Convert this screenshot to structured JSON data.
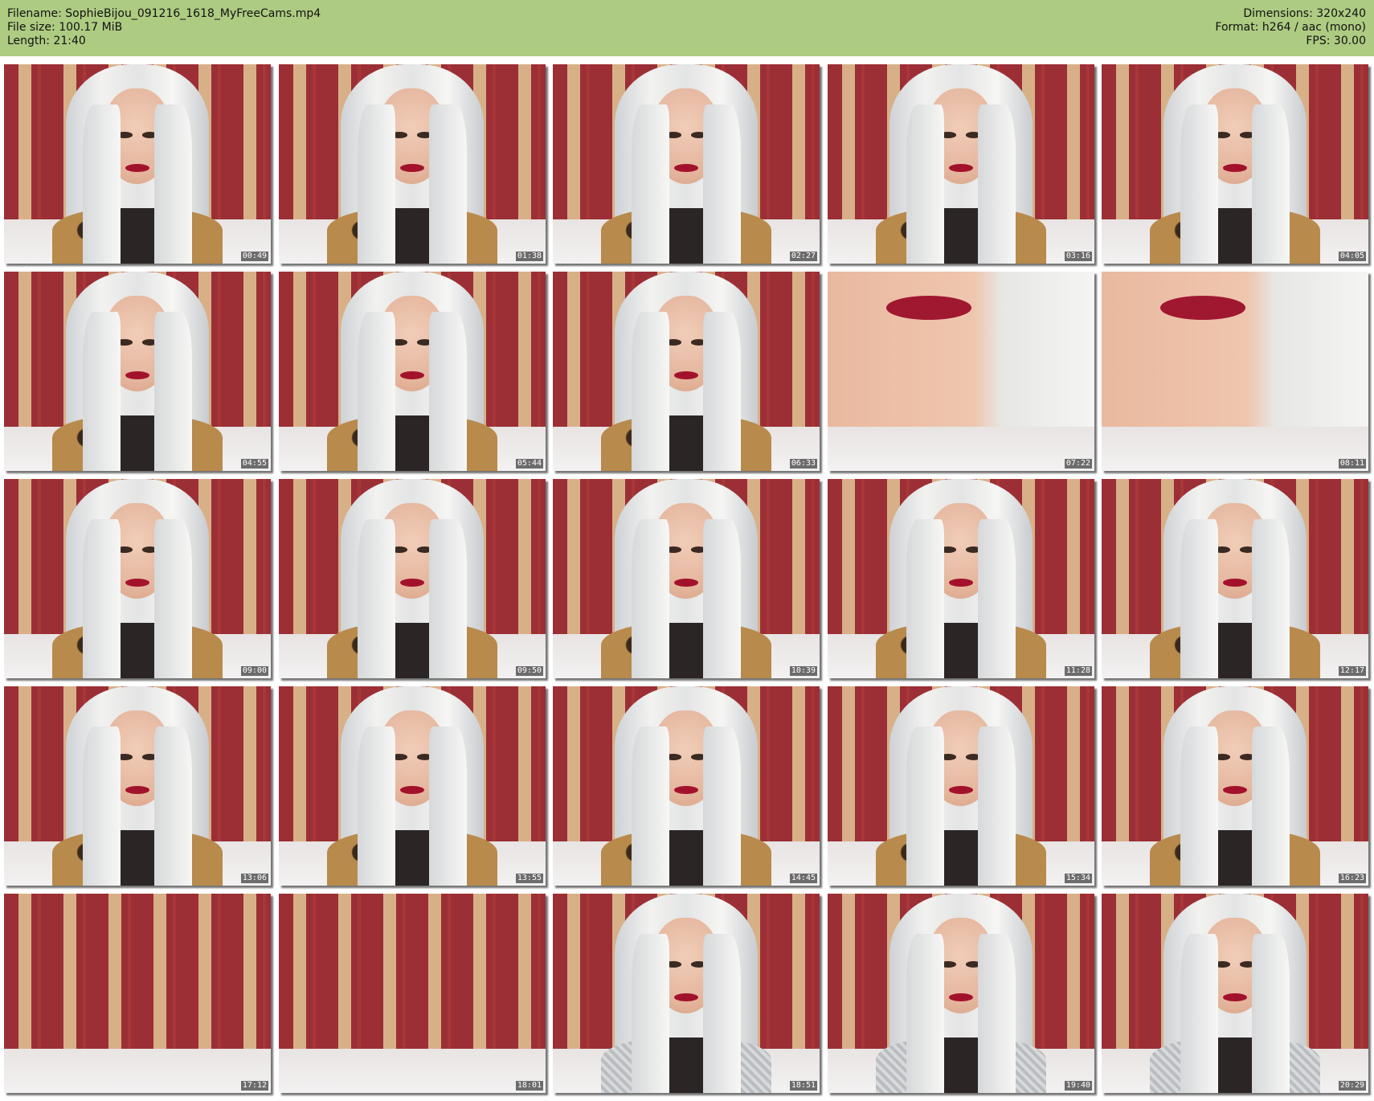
{
  "header": {
    "filename_line": "Filename: SophieBijou_091216_1618_MyFreeCams.mp4",
    "filesize_line": "File size: 100.17 MiB",
    "length_line": "Length: 21:40",
    "dimensions_line": "Dimensions: 320x240",
    "format_line": "Format: h264 / aac (mono)",
    "fps_line": "FPS: 30.00",
    "background_color": "#aecb82"
  },
  "thumbnails": [
    {
      "time": "00:49",
      "scene": "portrait"
    },
    {
      "time": "01:38",
      "scene": "portrait"
    },
    {
      "time": "02:27",
      "scene": "portrait"
    },
    {
      "time": "03:16",
      "scene": "portrait"
    },
    {
      "time": "04:05",
      "scene": "portrait"
    },
    {
      "time": "04:55",
      "scene": "portrait"
    },
    {
      "time": "05:44",
      "scene": "portrait"
    },
    {
      "time": "06:33",
      "scene": "portrait"
    },
    {
      "time": "07:22",
      "scene": "closeup"
    },
    {
      "time": "08:11",
      "scene": "closeup"
    },
    {
      "time": "09:00",
      "scene": "portrait"
    },
    {
      "time": "09:50",
      "scene": "portrait"
    },
    {
      "time": "10:39",
      "scene": "portrait"
    },
    {
      "time": "11:28",
      "scene": "portrait"
    },
    {
      "time": "12:17",
      "scene": "portrait"
    },
    {
      "time": "13:06",
      "scene": "portrait"
    },
    {
      "time": "13:55",
      "scene": "portrait"
    },
    {
      "time": "14:45",
      "scene": "portrait"
    },
    {
      "time": "15:34",
      "scene": "portrait"
    },
    {
      "time": "16:23",
      "scene": "portrait"
    },
    {
      "time": "17:12",
      "scene": "empty"
    },
    {
      "time": "18:01",
      "scene": "empty"
    },
    {
      "time": "18:51",
      "scene": "sweater"
    },
    {
      "time": "19:40",
      "scene": "sweater"
    },
    {
      "time": "20:29",
      "scene": "sweater"
    }
  ]
}
